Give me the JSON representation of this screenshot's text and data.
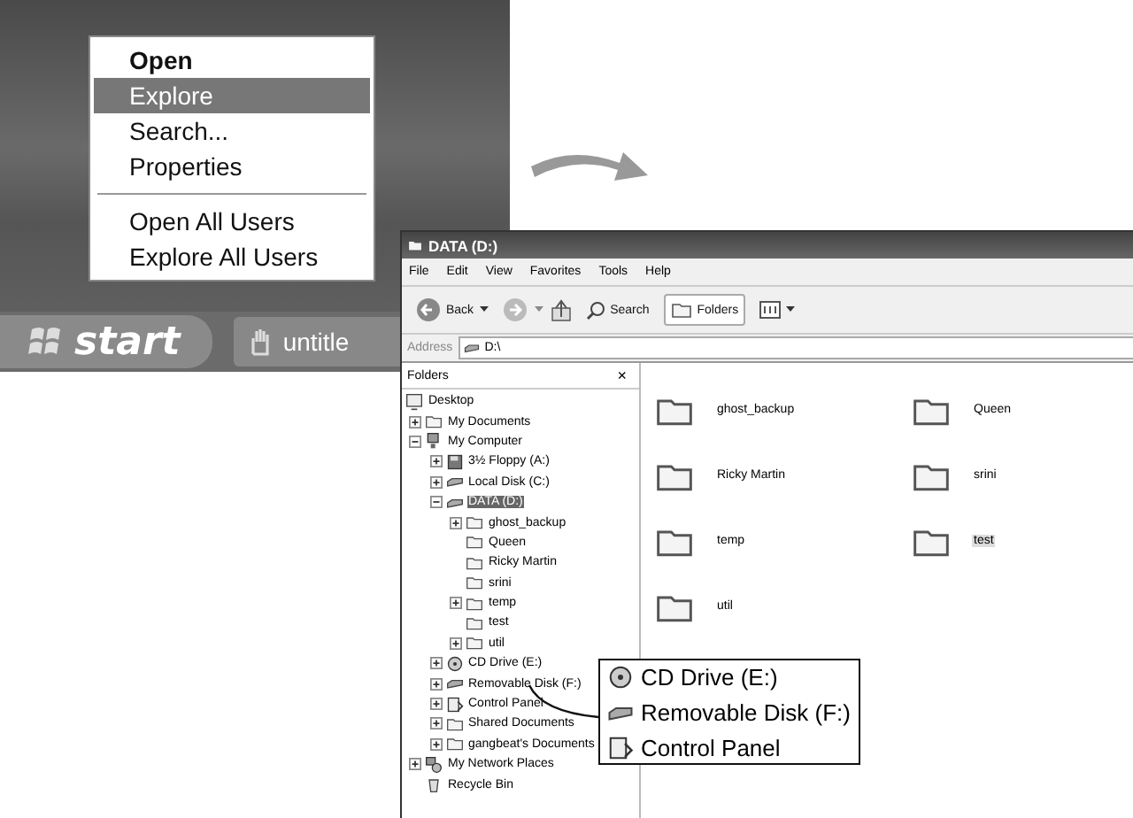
{
  "context_menu": {
    "groups": [
      [
        {
          "label": "Open",
          "kind": "default",
          "selected": false
        },
        {
          "label": "Explore",
          "kind": "normal",
          "selected": true
        },
        {
          "label": "Search...",
          "kind": "normal",
          "selected": false
        },
        {
          "label": "Properties",
          "kind": "normal",
          "selected": false
        }
      ],
      [
        {
          "label": "Open All Users",
          "kind": "normal",
          "selected": false
        },
        {
          "label": "Explore All Users",
          "kind": "normal",
          "selected": false
        }
      ]
    ]
  },
  "taskbar": {
    "start_label": "start",
    "task_label": "untitle"
  },
  "window": {
    "title": "DATA (D:)",
    "menu": [
      "File",
      "Edit",
      "View",
      "Favorites",
      "Tools",
      "Help"
    ],
    "toolbar": {
      "back": "Back",
      "search": "Search",
      "folders": "Folders"
    },
    "address": {
      "label": "Address",
      "value": "D:\\"
    },
    "folders_pane": {
      "title": "Folders",
      "close": "×"
    },
    "tree": [
      {
        "label": "Desktop",
        "kind": "desktop",
        "selected": false,
        "children": [
          {
            "label": "My Documents",
            "kind": "docs",
            "expanded": false,
            "selected": false
          },
          {
            "label": "My Computer",
            "kind": "computer",
            "expanded": true,
            "selected": false,
            "children": [
              {
                "label": "3½ Floppy (A:)",
                "kind": "floppy",
                "expanded": false,
                "selected": false
              },
              {
                "label": "Local Disk (C:)",
                "kind": "drive",
                "expanded": false,
                "selected": false
              },
              {
                "label": "DATA (D:)",
                "kind": "drive",
                "expanded": true,
                "selected": true,
                "children": [
                  {
                    "label": "ghost_backup",
                    "kind": "folder",
                    "expanded": false,
                    "selected": false
                  },
                  {
                    "label": "Queen",
                    "kind": "folder",
                    "selected": false
                  },
                  {
                    "label": "Ricky Martin",
                    "kind": "folder",
                    "selected": false
                  },
                  {
                    "label": "srini",
                    "kind": "folder",
                    "selected": false
                  },
                  {
                    "label": "temp",
                    "kind": "folder",
                    "expanded": false,
                    "selected": false
                  },
                  {
                    "label": "test",
                    "kind": "folder",
                    "selected": false
                  },
                  {
                    "label": "util",
                    "kind": "folder",
                    "expanded": false,
                    "selected": false
                  }
                ]
              },
              {
                "label": "CD Drive (E:)",
                "kind": "cd",
                "expanded": false,
                "selected": false
              },
              {
                "label": "Removable Disk (F:)",
                "kind": "drive",
                "expanded": false,
                "selected": false
              },
              {
                "label": "Control Panel",
                "kind": "panel",
                "expanded": false,
                "selected": false
              },
              {
                "label": "Shared Documents",
                "kind": "folder",
                "expanded": false,
                "selected": false
              },
              {
                "label": "gangbeat's Documents",
                "kind": "folder",
                "expanded": false,
                "selected": false
              }
            ]
          },
          {
            "label": "My Network Places",
            "kind": "network",
            "expanded": false,
            "selected": false
          },
          {
            "label": "Recycle Bin",
            "kind": "bin",
            "selected": false
          }
        ]
      }
    ],
    "files": [
      {
        "label": "ghost_backup",
        "selected": false
      },
      {
        "label": "Queen",
        "selected": false
      },
      {
        "label": "Ricky Martin",
        "selected": false
      },
      {
        "label": "srini",
        "selected": false
      },
      {
        "label": "temp",
        "selected": false
      },
      {
        "label": "test",
        "selected": true
      },
      {
        "label": "util",
        "selected": false
      }
    ]
  },
  "callout": {
    "lines": [
      {
        "label": "CD Drive (E:)",
        "kind": "cd"
      },
      {
        "label": "Removable Disk (F:)",
        "kind": "drive"
      },
      {
        "label": "Control Panel",
        "kind": "panel"
      }
    ]
  }
}
